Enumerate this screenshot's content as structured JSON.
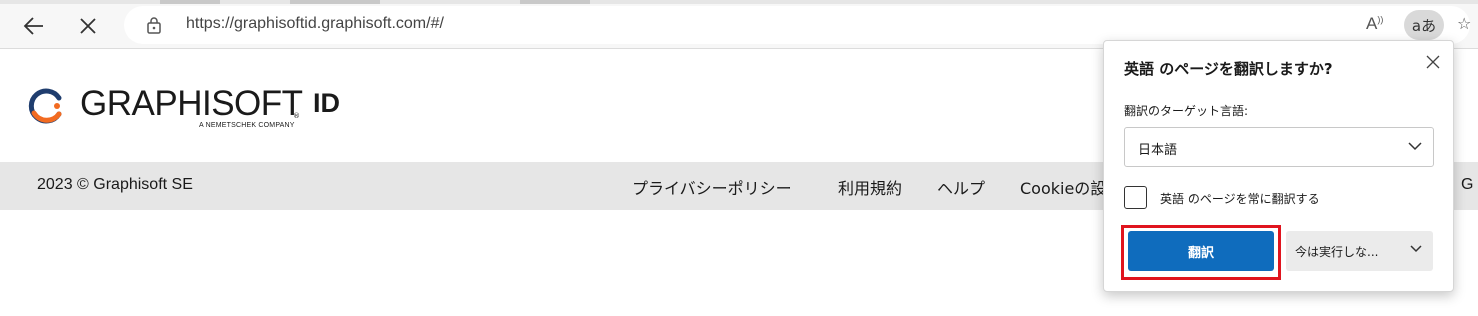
{
  "browser": {
    "url": "https://graphisoftid.graphisoft.com/#/",
    "read_aloud_label": "A",
    "translate_button_label": "aあ",
    "favorites_glyph": "☆"
  },
  "header": {
    "logo_text": "GRAPHISOFT",
    "logo_registered": "®",
    "logo_subtitle": "A NEMETSCHEK COMPANY",
    "logo_suffix": "ID"
  },
  "footer": {
    "copyright": "2023 © Graphisoft SE",
    "links": [
      "プライバシーポリシー",
      "利用規約",
      "ヘルプ",
      "Cookieの設"
    ],
    "trailing_text": "G"
  },
  "translate_popup": {
    "title": "英語 のページを翻訳しますか?",
    "target_language_label": "翻訳のターゲット言語:",
    "target_language_value": "日本語",
    "always_translate_label": "英語 のページを常に翻訳する",
    "always_translate_checked": false,
    "translate_button": "翻訳",
    "not_now_button": "今は実行しな..."
  },
  "colors": {
    "accent_blue": "#0f6cbd",
    "highlight_red": "#e0141e",
    "footer_bg": "#e6e6e6",
    "logo_orange": "#f26b21",
    "logo_navy": "#1f3d6e"
  }
}
